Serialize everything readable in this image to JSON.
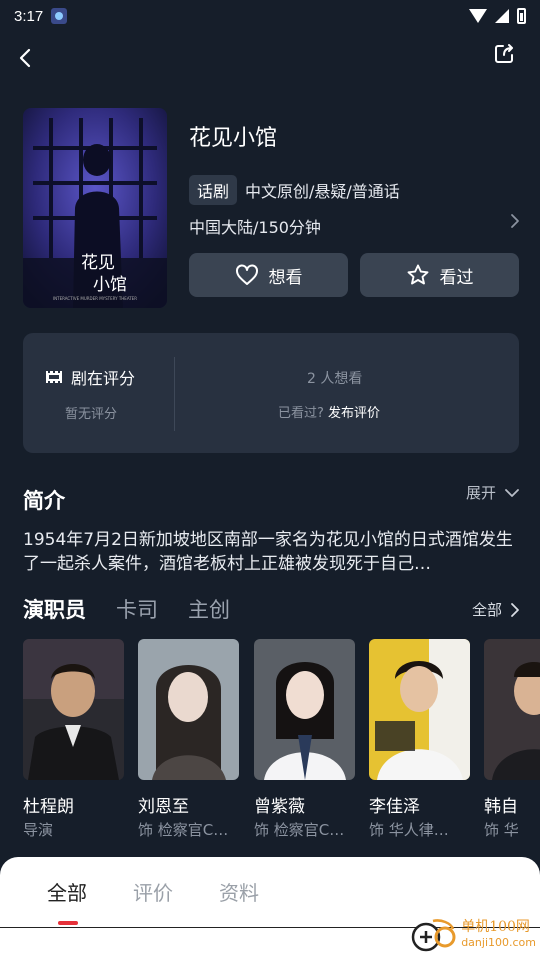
{
  "status_bar": {
    "time": "3:17"
  },
  "header": {
    "back_icon": "back-arrow-icon",
    "share_icon": "share-icon"
  },
  "show": {
    "title": "花见小馆",
    "genre_tag": "话剧",
    "categories": "中文原创/悬疑/普通话",
    "region_duration": "中国大陆/150分钟",
    "poster_title": "花见小馆",
    "poster_caption": "INTERACTIVE MURDER MYSTERY THEATER"
  },
  "actions": {
    "want_label": "想看",
    "seen_label": "看过"
  },
  "rating": {
    "label": "剧在评分",
    "none_text": "暂无评分",
    "want_count_text": "2 人想看",
    "seen_prompt": "已看过?",
    "publish_review": "发布评价"
  },
  "synopsis": {
    "title": "简介",
    "expand_label": "展开",
    "text": "1954年7月2日新加坡地区南部一家名为花见小馆的日式酒馆发生了一起杀人案件，酒馆老板村上正雄被发现死于自己…"
  },
  "cast_tabs": [
    "演职员",
    "卡司",
    "主创"
  ],
  "cast_all_label": "全部",
  "cast": [
    {
      "name": "杜程朗",
      "role": "导演"
    },
    {
      "name": "刘恩至",
      "role": "饰 检察官C…"
    },
    {
      "name": "曾紫薇",
      "role": "饰 检察官C…"
    },
    {
      "name": "李佳泽",
      "role": "饰 华人律…"
    },
    {
      "name": "韩自",
      "role": "饰 华"
    }
  ],
  "bottom_tabs": [
    "全部",
    "评价",
    "资料"
  ],
  "watermark": {
    "cn": "单机100网",
    "en": "danji100.com"
  },
  "colors": {
    "background": "#161e2a",
    "card": "#283140",
    "button": "#3a4452",
    "accent_red": "#e6313a",
    "watermark": "#e89a2c"
  }
}
